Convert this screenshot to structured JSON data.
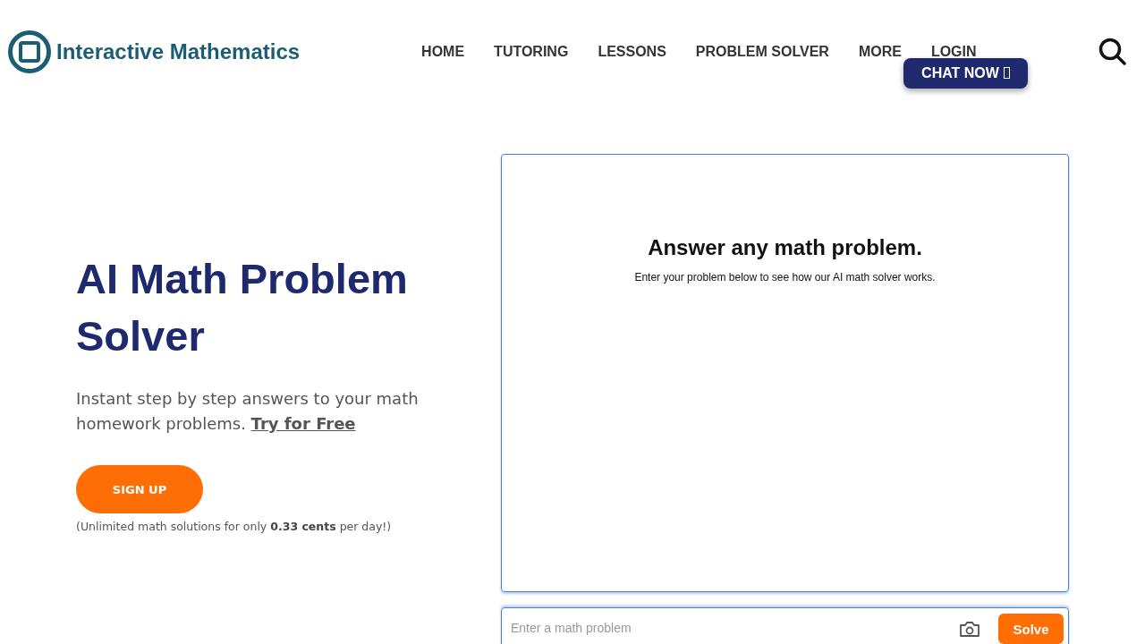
{
  "header": {
    "logo_text": "Interactive Mathematics",
    "nav": [
      {
        "label": "HOME"
      },
      {
        "label": "TUTORING"
      },
      {
        "label": "LESSONS"
      },
      {
        "label": "PROBLEM SOLVER"
      },
      {
        "label": "MORE"
      },
      {
        "label": "LOGIN"
      }
    ],
    "chat_button": "CHAT NOW"
  },
  "hero": {
    "title": "AI Math Problem Solver",
    "subtitle": "Instant step by step answers to your math homework problems.",
    "subtitle_link": "Try for Free",
    "signup_button": "SIGN UP",
    "note": "(Unlimited math solutions for only **0.33 cents** per day!)"
  },
  "solver": {
    "heading": "Answer any math problem.",
    "description": "Enter your problem below to see how our AI math solver works.",
    "input": {
      "placeholder": "Enter a math problem"
    },
    "solve_button": "Solve"
  }
}
